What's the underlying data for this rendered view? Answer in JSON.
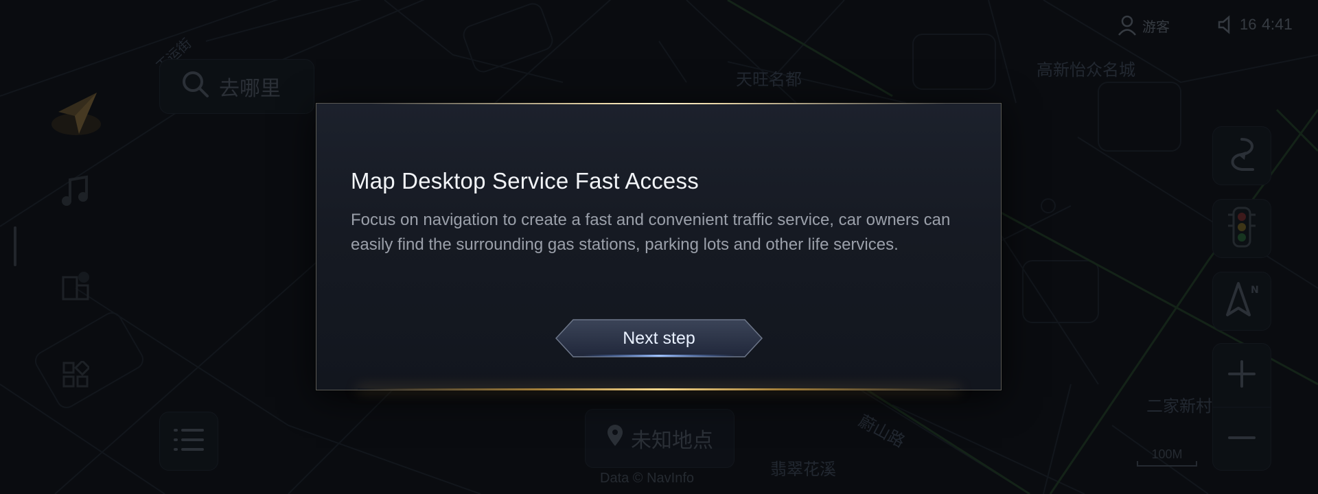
{
  "status_bar": {
    "user_label": "游客",
    "volume_level": "16",
    "time": "4:41"
  },
  "map": {
    "labels": [
      "天旺名都",
      "高新怡众名城",
      "蔚山路",
      "翡翠花溪",
      "二家新村",
      "王运街"
    ]
  },
  "search": {
    "placeholder": "去哪里",
    "icon": "search-icon"
  },
  "left_rail": {
    "items": [
      {
        "icon": "navigation-arrow-icon"
      },
      {
        "icon": "music-note-icon"
      },
      {
        "icon": "building-icon"
      },
      {
        "icon": "app-grid-icon"
      }
    ]
  },
  "location_chip": {
    "icon": "location-pin-icon",
    "label": "未知地点"
  },
  "attribution": "Data © NavInfo",
  "right_controls": {
    "items": [
      {
        "icon": "route-icon"
      },
      {
        "icon": "traffic-light-icon"
      },
      {
        "icon": "north-compass-icon"
      },
      {
        "icon": "zoom-in-icon"
      },
      {
        "icon": "zoom-out-icon"
      }
    ]
  },
  "scale": "100M",
  "dialog": {
    "title": "Map Desktop Service Fast Access",
    "body": "Focus on navigation to create a fast and convenient traffic service, car owners can easily find the surrounding gas stations, parking lots and other life services.",
    "next_label": "Next step"
  },
  "colors": {
    "background": "#0d1014",
    "dialog_border_glow": "#f6d78c",
    "button_accent": "#4a7bd8"
  }
}
